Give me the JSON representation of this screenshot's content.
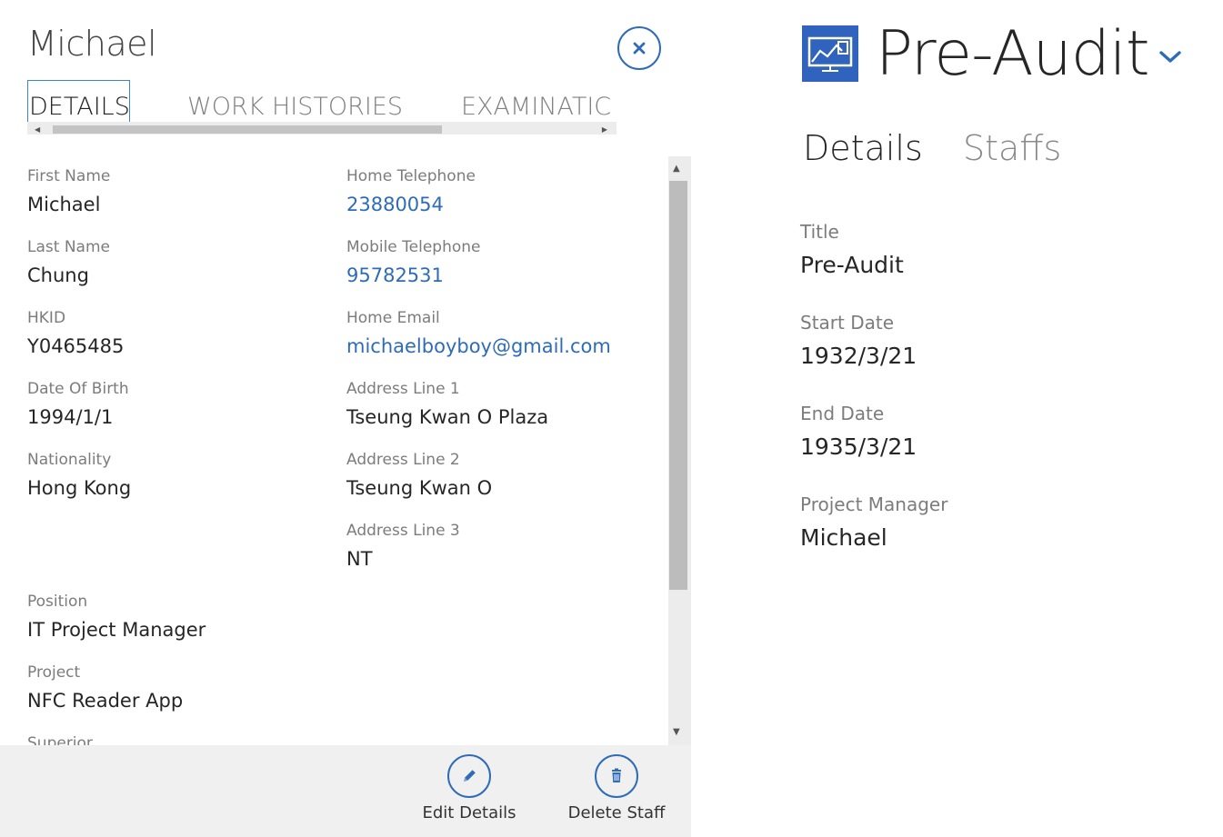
{
  "staff": {
    "title": "Michael",
    "tabs": [
      {
        "label": "DETAILS",
        "selected": true
      },
      {
        "label": "WORK HISTORIES",
        "selected": false
      },
      {
        "label": "EXAMINATIC",
        "selected": false
      }
    ],
    "left_column": [
      {
        "label": "First Name",
        "value": "Michael"
      },
      {
        "label": "Last Name",
        "value": "Chung"
      },
      {
        "label": "HKID",
        "value": "Y0465485"
      },
      {
        "label": "Date Of Birth",
        "value": "1994/1/1"
      },
      {
        "label": "Nationality",
        "value": "Hong Kong"
      }
    ],
    "right_column": [
      {
        "label": "Home Telephone",
        "value": "23880054"
      },
      {
        "label": "Mobile Telephone",
        "value": "95782531"
      },
      {
        "label": "Home Email",
        "value": "michaelboyboy@gmail.com"
      },
      {
        "label": "Address Line 1",
        "value": "Tseung Kwan O Plaza"
      },
      {
        "label": "Address Line 2",
        "value": "Tseung Kwan O"
      },
      {
        "label": "Address Line 3",
        "value": "NT"
      }
    ],
    "lower_fields": [
      {
        "label": "Position",
        "value": "IT Project Manager"
      },
      {
        "label": "Project",
        "value": "NFC Reader App"
      },
      {
        "label": "Superior",
        "value": ""
      }
    ],
    "commands": {
      "edit_label": "Edit Details",
      "delete_label": "Delete Staff"
    },
    "icons": {
      "close": "close-icon",
      "edit": "pencil-icon",
      "delete": "trash-icon"
    }
  },
  "project": {
    "title": "Pre-Audit",
    "tabs": [
      {
        "label": "Details",
        "selected": true
      },
      {
        "label": "Staffs",
        "selected": false
      }
    ],
    "fields": [
      {
        "label": "Title",
        "value": "Pre-Audit"
      },
      {
        "label": "Start Date",
        "value": "1932/3/21"
      },
      {
        "label": "End Date",
        "value": "1935/3/21"
      },
      {
        "label": "Project Manager",
        "value": "Michael"
      }
    ],
    "icons": {
      "logo": "chart-board-icon",
      "menu": "chevron-down-icon"
    }
  },
  "colors": {
    "accent": "#2f6cb8",
    "logo_blue": "#2f63bd",
    "command_bar": "#f0f0f0",
    "label_gray": "#7c7c7c",
    "text": "#262626"
  }
}
